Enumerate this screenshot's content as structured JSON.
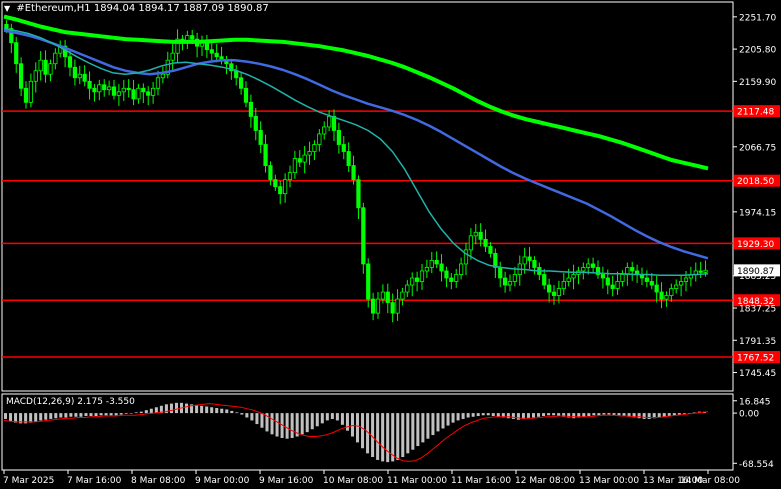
{
  "header": {
    "symbol": "#Ethereum,H1",
    "ohlc": "1894.04 1894.17 1887.09 1890.87"
  },
  "colors": {
    "background": "#000000",
    "bull_candle": "#00ff00",
    "bear_candle": "#00ff00",
    "ma_slow": "#00ff00",
    "ma_medium": "#4169e1",
    "ma_fast": "#20b2aa",
    "level_line": "#ff0000",
    "macd_hist": "#c0c0c0",
    "macd_signal": "#ff0000"
  },
  "chart_data": [
    {
      "type": "line",
      "title": "#Ethereum,H1",
      "ylim": [
        1722.0,
        2270.0
      ],
      "x_tick_labels": [
        "7 Mar 2025",
        "7 Mar 16:00",
        "8 Mar 08:00",
        "9 Mar 00:00",
        "9 Mar 16:00",
        "10 Mar 08:00",
        "11 Mar 00:00",
        "11 Mar 16:00",
        "12 Mar 08:00",
        "13 Mar 00:00",
        "13 Mar 16:00",
        "14 Mar 08:00"
      ],
      "y_tick_labels": [
        "2251.70",
        "2205.80",
        "2159.90",
        "2066.75",
        "1974.15",
        "1883.25",
        "1837.25",
        "1791.35",
        "1745.45"
      ],
      "current_price": "1890.87",
      "levels": [
        {
          "price": 2117.48,
          "label": "2117.48"
        },
        {
          "price": 2018.5,
          "label": "2018.50"
        },
        {
          "price": 1929.3,
          "label": "1929.30"
        },
        {
          "price": 1848.32,
          "label": "1848.32"
        },
        {
          "price": 1767.52,
          "label": "1767.52"
        }
      ],
      "close": [
        2235,
        2215,
        2185,
        2150,
        2130,
        2160,
        2175,
        2190,
        2170,
        2185,
        2200,
        2210,
        2195,
        2180,
        2165,
        2170,
        2160,
        2150,
        2145,
        2155,
        2148,
        2152,
        2140,
        2145,
        2150,
        2148,
        2135,
        2150,
        2145,
        2140,
        2150,
        2165,
        2170,
        2190,
        2200,
        2220,
        2215,
        2225,
        2220,
        2210,
        2215,
        2205,
        2200,
        2195,
        2190,
        2185,
        2175,
        2165,
        2150,
        2130,
        2110,
        2090,
        2070,
        2040,
        2020,
        2010,
        2000,
        2020,
        2030,
        2050,
        2045,
        2055,
        2060,
        2070,
        2085,
        2095,
        2110,
        2090,
        2070,
        2060,
        2040,
        2020,
        1980,
        1900,
        1850,
        1830,
        1850,
        1860,
        1845,
        1830,
        1850,
        1860,
        1870,
        1880,
        1875,
        1890,
        1895,
        1905,
        1900,
        1890,
        1880,
        1875,
        1885,
        1900,
        1920,
        1940,
        1945,
        1935,
        1925,
        1915,
        1895,
        1880,
        1870,
        1875,
        1885,
        1900,
        1910,
        1905,
        1895,
        1885,
        1870,
        1860,
        1855,
        1865,
        1875,
        1880,
        1885,
        1890,
        1895,
        1900,
        1895,
        1885,
        1880,
        1870,
        1865,
        1875,
        1885,
        1895,
        1890,
        1885,
        1880,
        1875,
        1870,
        1860,
        1850,
        1855,
        1865,
        1870,
        1875,
        1880,
        1885,
        1890,
        1888,
        1891
      ],
      "series": [
        {
          "name": "",
          "values": [
            2252,
            2248,
            2243,
            2238,
            2234,
            2230,
            2228,
            2226,
            2224,
            2222,
            2220,
            2219,
            2218,
            2217,
            2216,
            2216,
            2216,
            2217,
            2218,
            2219,
            2219,
            2218,
            2217,
            2216,
            2214,
            2212,
            2210,
            2207,
            2204,
            2200,
            2196,
            2191,
            2186,
            2180,
            2173,
            2166,
            2158,
            2150,
            2141,
            2132,
            2124,
            2117,
            2111,
            2106,
            2102,
            2098,
            2094,
            2090,
            2086,
            2082,
            2077,
            2072,
            2066,
            2060,
            2054,
            2048,
            2044,
            2040,
            2036
          ]
        },
        {
          "name": "",
          "values": [
            2232,
            2229,
            2225,
            2220,
            2214,
            2208,
            2201,
            2194,
            2187,
            2180,
            2175,
            2172,
            2170,
            2172,
            2175,
            2180,
            2185,
            2188,
            2190,
            2190,
            2188,
            2185,
            2181,
            2176,
            2170,
            2163,
            2155,
            2147,
            2140,
            2134,
            2128,
            2123,
            2118,
            2112,
            2105,
            2097,
            2088,
            2078,
            2068,
            2058,
            2048,
            2038,
            2029,
            2021,
            2014,
            2007,
            2000,
            1993,
            1986,
            1977,
            1968,
            1958,
            1948,
            1939,
            1931,
            1924,
            1918,
            1913,
            1908
          ]
        },
        {
          "name": "",
          "values": [
            2235,
            2232,
            2228,
            2222,
            2214,
            2205,
            2195,
            2186,
            2178,
            2172,
            2170,
            2172,
            2176,
            2182,
            2186,
            2187,
            2185,
            2183,
            2180,
            2176,
            2170,
            2162,
            2153,
            2143,
            2133,
            2124,
            2116,
            2110,
            2104,
            2098,
            2090,
            2078,
            2060,
            2035,
            2005,
            1975,
            1950,
            1930,
            1915,
            1905,
            1898,
            1895,
            1893,
            1892,
            1890,
            1890,
            1889,
            1888,
            1888,
            1887,
            1886,
            1886,
            1885,
            1885,
            1884,
            1884,
            1884,
            1885,
            1886
          ]
        }
      ]
    },
    {
      "type": "bar",
      "title": "MACD(12,26,9) 2.175 -3.550",
      "ylim": [
        -75,
        22
      ],
      "y_tick_labels": [
        "16.845",
        "0.00",
        "-68.554"
      ],
      "macd": [
        -8,
        -11,
        -13,
        -14,
        -14,
        -13,
        -12,
        -10,
        -9,
        -8,
        -7,
        -6,
        -6,
        -5,
        -5,
        -5,
        -4,
        -4,
        -4,
        -3,
        -3,
        -3,
        -3,
        -2,
        -1,
        0,
        1,
        2,
        4,
        6,
        8,
        10,
        12,
        13,
        14,
        14,
        13,
        12,
        11,
        10,
        9,
        8,
        7,
        6,
        5,
        3,
        1,
        -2,
        -6,
        -10,
        -15,
        -20,
        -25,
        -29,
        -32,
        -34,
        -35,
        -34,
        -32,
        -29,
        -26,
        -22,
        -18,
        -14,
        -10,
        -8,
        -10,
        -16,
        -24,
        -32,
        -40,
        -48,
        -55,
        -60,
        -64,
        -66,
        -67,
        -66,
        -64,
        -60,
        -55,
        -50,
        -45,
        -40,
        -35,
        -30,
        -25,
        -21,
        -17,
        -13,
        -10,
        -8,
        -6,
        -5,
        -4,
        -3,
        -3,
        -4,
        -5,
        -6,
        -7,
        -8,
        -9,
        -8,
        -7,
        -6,
        -5,
        -4,
        -3,
        -3,
        -4,
        -5,
        -6,
        -7,
        -6,
        -5,
        -4,
        -3,
        -3,
        -2,
        -2,
        -3,
        -3,
        -4,
        -5,
        -6,
        -7,
        -8,
        -8,
        -7,
        -6,
        -5,
        -4,
        -3,
        -2,
        -1,
        0,
        1,
        2,
        2
      ],
      "signal": [
        -10,
        -11,
        -12,
        -12,
        -12,
        -12,
        -11,
        -10,
        -9,
        -8,
        -7,
        -7,
        -6,
        -6,
        -5,
        -5,
        -4,
        -4,
        -4,
        -3,
        -3,
        -3,
        -2,
        -1,
        0,
        1,
        2,
        4,
        6,
        8,
        10,
        11,
        12,
        13,
        12,
        11,
        10,
        9,
        8,
        6,
        4,
        1,
        -3,
        -8,
        -13,
        -18,
        -23,
        -27,
        -30,
        -32,
        -32,
        -31,
        -29,
        -26,
        -22,
        -19,
        -17,
        -18,
        -23,
        -31,
        -40,
        -48,
        -55,
        -61,
        -65,
        -66,
        -65,
        -61,
        -55,
        -48,
        -41,
        -34,
        -28,
        -22,
        -17,
        -13,
        -10,
        -7,
        -6,
        -5,
        -5,
        -5,
        -6,
        -7,
        -7,
        -7,
        -6,
        -5,
        -5,
        -4,
        -4,
        -5,
        -5,
        -5,
        -5,
        -4,
        -3,
        -3,
        -3,
        -4,
        -4,
        -5,
        -5,
        -6,
        -6,
        -6,
        -5,
        -4,
        -3,
        -2,
        -1,
        0,
        1,
        2
      ]
    }
  ]
}
